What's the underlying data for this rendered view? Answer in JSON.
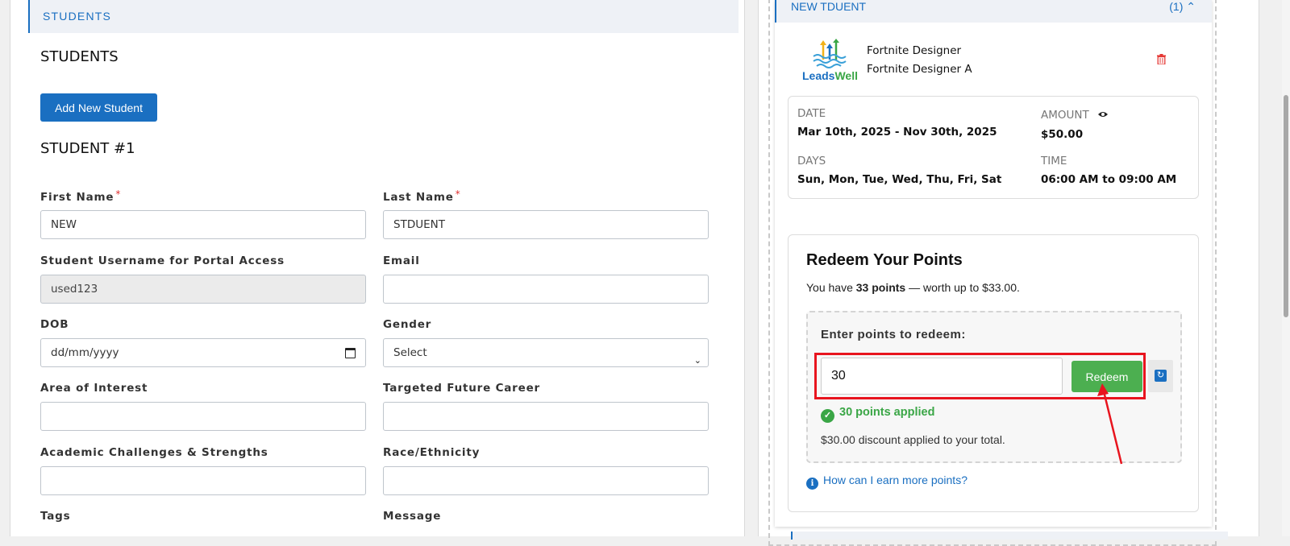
{
  "left": {
    "section_header": "STUDENTS",
    "title": "STUDENTS",
    "add_button": "Add New Student",
    "student_heading": "STUDENT #1",
    "fields": {
      "first_name": {
        "label": "First Name",
        "required": "*",
        "value": "NEW"
      },
      "last_name": {
        "label": "Last Name",
        "required": "*",
        "value": "STDUENT"
      },
      "username": {
        "label": "Student Username for Portal Access",
        "value": "used123"
      },
      "email": {
        "label": "Email",
        "value": ""
      },
      "dob": {
        "label": "DOB",
        "placeholder": "dd/mm/yyyy"
      },
      "gender": {
        "label": "Gender",
        "value": "Select"
      },
      "area_of_interest": {
        "label": "Area of Interest",
        "value": ""
      },
      "career": {
        "label": "Targeted Future Career",
        "value": ""
      },
      "academic": {
        "label": "Academic Challenges & Strengths",
        "value": ""
      },
      "race": {
        "label": "Race/Ethnicity",
        "value": ""
      },
      "tags": {
        "label": "Tags"
      },
      "message": {
        "label": "Message"
      }
    }
  },
  "right": {
    "card_title": "NEW TDUENT",
    "card_count": "(1)",
    "logo_text_1": "Leads",
    "logo_text_2": "Well",
    "program_line1": "Fortnite Designer",
    "program_line2": "Fortnite Designer A",
    "info": {
      "date_label": "DATE",
      "date_value": "Mar 10th, 2025 - Nov 30th, 2025",
      "amount_label": "AMOUNT",
      "amount_value": "$50.00",
      "days_label": "DAYS",
      "days_value": "Sun, Mon, Tue, Wed, Thu, Fri, Sat",
      "time_label": "TIME",
      "time_value": "06:00 AM to 09:00 AM"
    },
    "redeem": {
      "title": "Redeem Your Points",
      "sub_prefix": "You have",
      "points_bold": "33 points",
      "sub_suffix": "— worth up to $33.00.",
      "enter_label": "Enter points to redeem:",
      "input_value": "30",
      "button": "Redeem",
      "applied": "30 points applied",
      "discount_text": "$30.00 discount applied to your total.",
      "earn_link": "How can I earn more points?"
    }
  },
  "colors": {
    "primary": "#1a6fc1",
    "success": "#4caf50",
    "highlight": "#e8141e"
  }
}
